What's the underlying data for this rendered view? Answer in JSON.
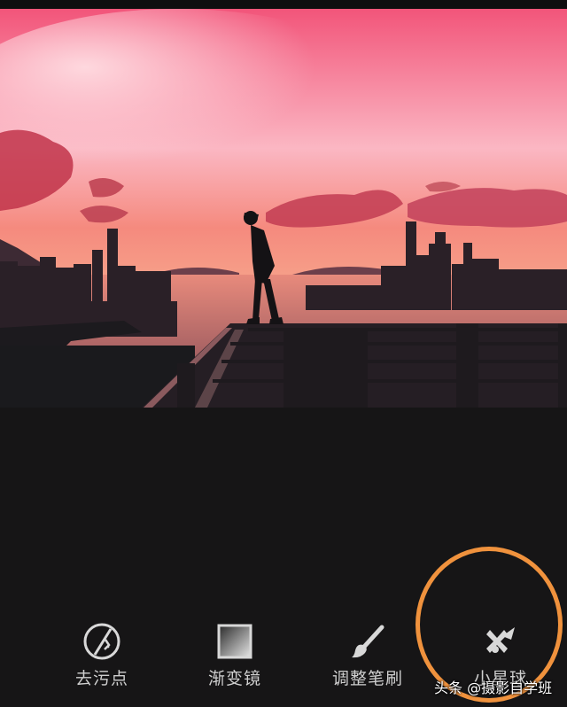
{
  "tools": [
    {
      "label": "去污点",
      "icon": "healing-icon"
    },
    {
      "label": "渐变镜",
      "icon": "gradient-filter-icon"
    },
    {
      "label": "调整笔刷",
      "icon": "brush-icon"
    },
    {
      "label": "小星球",
      "icon": "tiny-planet-icon"
    }
  ],
  "watermark": "头条 @摄影自学班",
  "colors": {
    "background": "#161516",
    "label": "#cfcfcf",
    "highlight_ring": "#f0923d",
    "sky_top": "#f2557a",
    "sky_horizon": "#f6a089"
  }
}
